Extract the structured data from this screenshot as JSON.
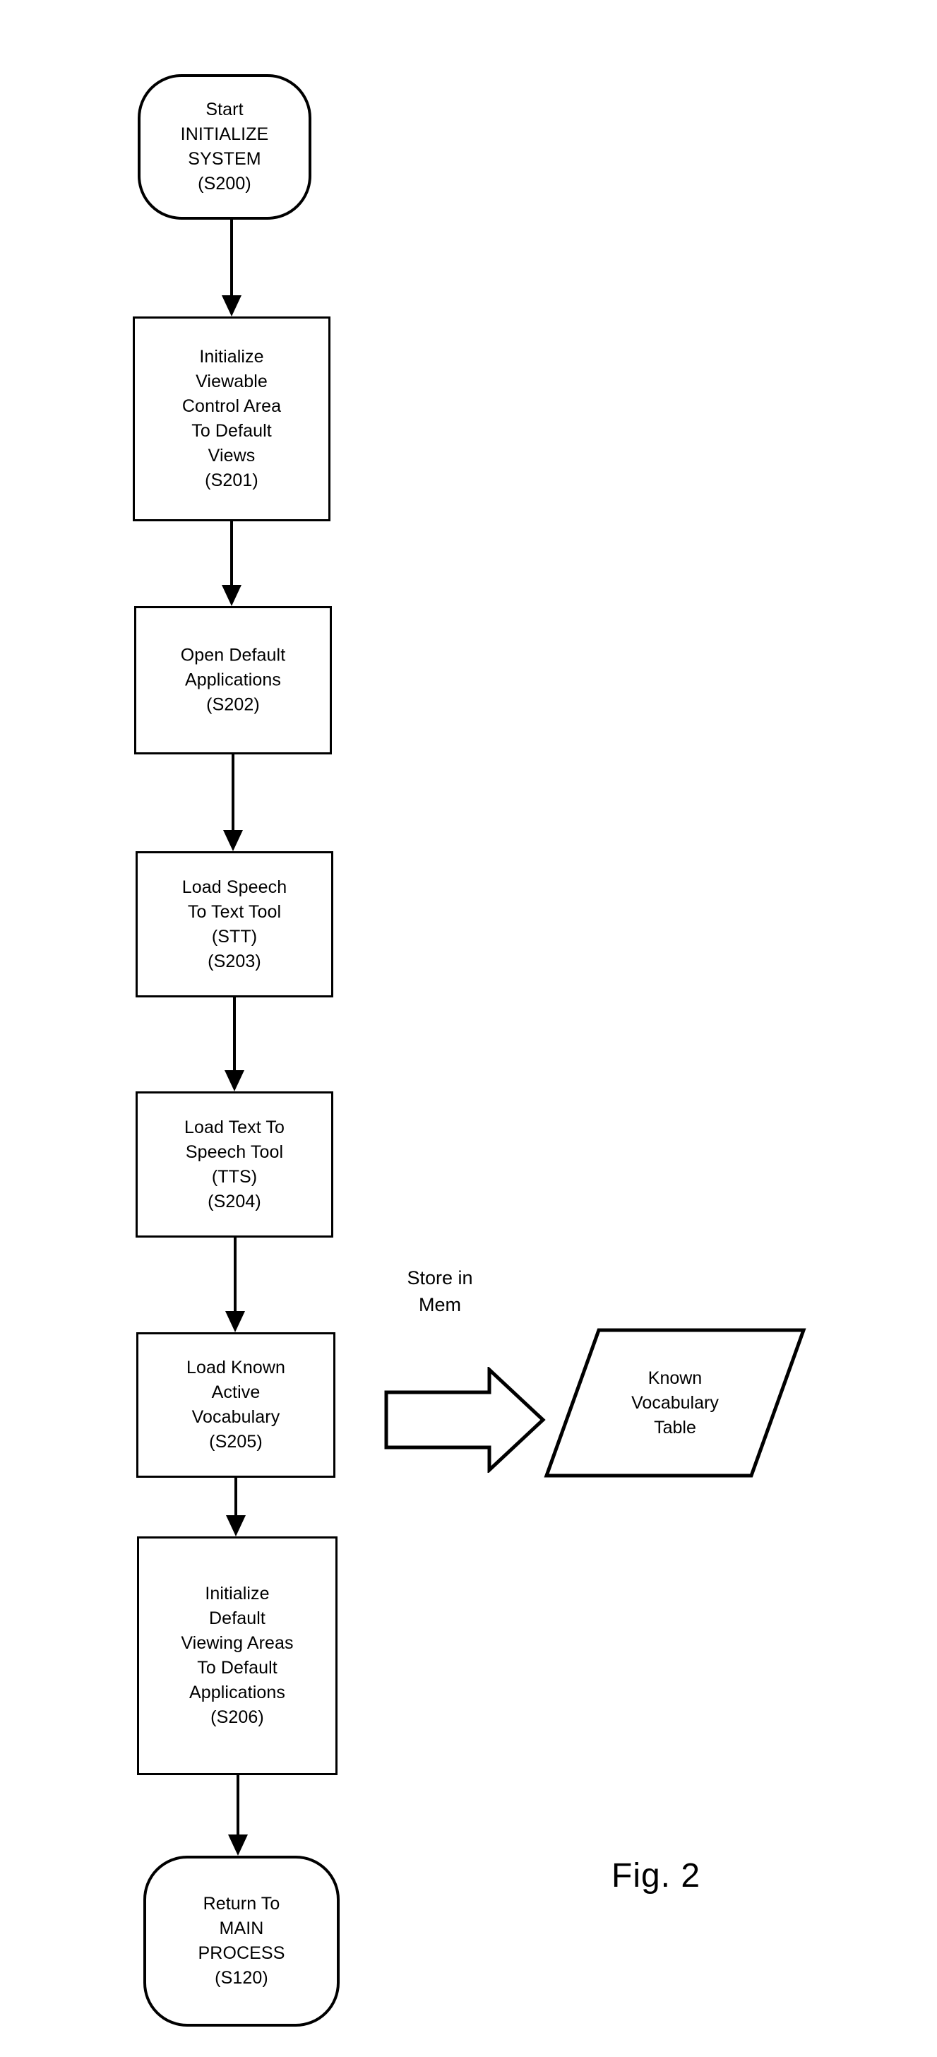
{
  "figure": {
    "caption": "Fig. 2"
  },
  "diagram": {
    "type": "flowchart",
    "orientation": "top-to-bottom",
    "nodes": [
      {
        "id": "S200",
        "shape": "terminator",
        "label": "Start\nINITIALIZE\nSYSTEM\n(S200)"
      },
      {
        "id": "S201",
        "shape": "process",
        "label": "Initialize\nViewable\nControl Area\nTo  Default\nViews\n(S201)"
      },
      {
        "id": "S202",
        "shape": "process",
        "label": "Open Default\nApplications\n(S202)"
      },
      {
        "id": "S203",
        "shape": "process",
        "label": "Load Speech\nTo Text Tool\n(STT)\n(S203)"
      },
      {
        "id": "S204",
        "shape": "process",
        "label": "Load Text To\nSpeech Tool\n(TTS)\n(S204)"
      },
      {
        "id": "S205",
        "shape": "process",
        "label": "Load Known\nActive\nVocabulary\n(S205)"
      },
      {
        "id": "S206",
        "shape": "process",
        "label": "Initialize\nDefault\nViewing Areas\nTo Default\nApplications\n(S206)"
      },
      {
        "id": "S120",
        "shape": "terminator",
        "label": "Return To\nMAIN\nPROCESS\n(S120)"
      },
      {
        "id": "VOCAB_TABLE",
        "shape": "parallelogram",
        "label": "Known\nVocabulary\nTable"
      }
    ],
    "edges": [
      {
        "from": "S200",
        "to": "S201",
        "style": "arrow"
      },
      {
        "from": "S201",
        "to": "S202",
        "style": "arrow"
      },
      {
        "from": "S202",
        "to": "S203",
        "style": "arrow"
      },
      {
        "from": "S203",
        "to": "S204",
        "style": "arrow"
      },
      {
        "from": "S204",
        "to": "S205",
        "style": "arrow"
      },
      {
        "from": "S205",
        "to": "VOCAB_TABLE",
        "style": "block-arrow",
        "label": "Store in\nMem"
      },
      {
        "from": "S205",
        "to": "S206",
        "style": "arrow"
      },
      {
        "from": "S206",
        "to": "S120",
        "style": "arrow"
      }
    ],
    "annotations": [
      {
        "id": "store-in-mem",
        "text": "Store in\nMem"
      }
    ],
    "colors": {
      "stroke": "#000000",
      "fill": "#ffffff",
      "text": "#000000"
    }
  }
}
